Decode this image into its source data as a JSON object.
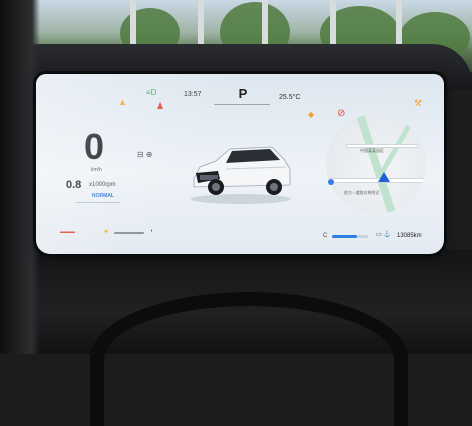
{
  "status_bar": {
    "time": "13:57",
    "gear": "P",
    "temperature": "25.5°C"
  },
  "speed": {
    "value": "0",
    "unit": "km/h"
  },
  "rpm": {
    "value": "0.8",
    "unit": "x1000rpm",
    "mode": "NORMAL"
  },
  "navigation": {
    "label_top": "中国某某园区",
    "label_mid": "前方 / 道路名称附近"
  },
  "bottom_bar": {
    "left_label": "▬▬▬",
    "range_label": "C",
    "battery_level": 0.7,
    "odometer": "13085km"
  },
  "colors": {
    "accent_blue": "#2f7fe0",
    "warning_red": "#e04a3a",
    "warning_yellow": "#f2a331",
    "indicator_green": "#2fb34a"
  }
}
